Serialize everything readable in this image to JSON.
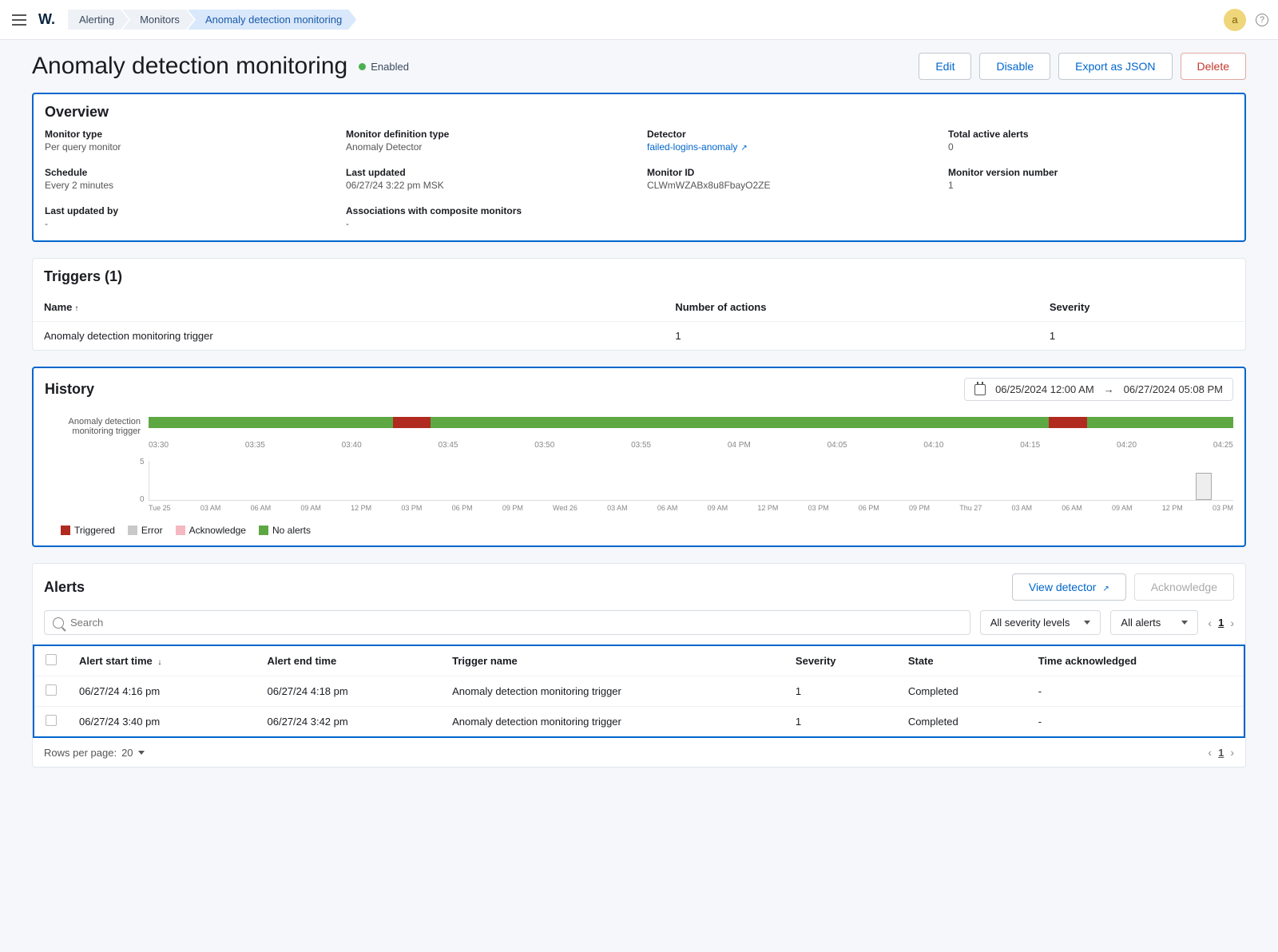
{
  "topbar": {
    "logo": "W.",
    "breadcrumbs": [
      "Alerting",
      "Monitors",
      "Anomaly detection monitoring"
    ],
    "avatar": "a"
  },
  "header": {
    "title": "Anomaly detection monitoring",
    "status": "Enabled",
    "actions": {
      "edit": "Edit",
      "disable": "Disable",
      "export": "Export as JSON",
      "delete": "Delete"
    }
  },
  "overview": {
    "title": "Overview",
    "monitor_type": {
      "label": "Monitor type",
      "value": "Per query monitor"
    },
    "definition_type": {
      "label": "Monitor definition type",
      "value": "Anomaly Detector"
    },
    "detector": {
      "label": "Detector",
      "value": "failed-logins-anomaly"
    },
    "total_active": {
      "label": "Total active alerts",
      "value": "0"
    },
    "schedule": {
      "label": "Schedule",
      "value": "Every 2 minutes"
    },
    "last_updated": {
      "label": "Last updated",
      "value": "06/27/24 3:22 pm MSK"
    },
    "monitor_id": {
      "label": "Monitor ID",
      "value": "CLWmWZABx8u8FbayO2ZE"
    },
    "version": {
      "label": "Monitor version number",
      "value": "1"
    },
    "last_updated_by": {
      "label": "Last updated by",
      "value": "-"
    },
    "associations": {
      "label": "Associations with composite monitors",
      "value": "-"
    }
  },
  "triggers": {
    "title": "Triggers (1)",
    "columns": {
      "name": "Name",
      "actions": "Number of actions",
      "severity": "Severity"
    },
    "rows": [
      {
        "name": "Anomaly detection monitoring trigger",
        "actions": "1",
        "severity": "1"
      }
    ]
  },
  "history": {
    "title": "History",
    "range_from": "06/25/2024 12:00 AM",
    "range_arrow": "→",
    "range_to": "06/27/2024 05:08 PM",
    "row_label": "Anomaly detection monitoring trigger",
    "ticks1": [
      "03:30",
      "03:35",
      "03:40",
      "03:45",
      "03:50",
      "03:55",
      "04 PM",
      "04:05",
      "04:10",
      "04:15",
      "04:20",
      "04:25"
    ],
    "y5": "5",
    "y0": "0",
    "ticks2": [
      "Tue 25",
      "03 AM",
      "06 AM",
      "09 AM",
      "12 PM",
      "03 PM",
      "06 PM",
      "09 PM",
      "Wed 26",
      "03 AM",
      "06 AM",
      "09 AM",
      "12 PM",
      "03 PM",
      "06 PM",
      "09 PM",
      "Thu 27",
      "03 AM",
      "06 AM",
      "09 AM",
      "12 PM",
      "03 PM"
    ],
    "legend": {
      "triggered": "Triggered",
      "error": "Error",
      "ack": "Acknowledge",
      "no": "No alerts"
    }
  },
  "chart_data": {
    "type": "bar",
    "timeline": {
      "label": "Anomaly detection monitoring trigger",
      "range": [
        "03:27",
        "04:29"
      ],
      "base_state": "no_alerts",
      "triggered_segments": [
        {
          "start": "03:41",
          "end": "03:43"
        },
        {
          "start": "04:17",
          "end": "04:19"
        }
      ]
    },
    "overview_chart": {
      "x_range": [
        "2024-06-25 00:00",
        "2024-06-27 17:08"
      ],
      "ylim": [
        0,
        5
      ],
      "brush": [
        "2024-06-27 15:27",
        "2024-06-27 16:29"
      ]
    },
    "legend_colors": {
      "Triggered": "#b02a1f",
      "Error": "#c9c9c9",
      "Acknowledge": "#f5b8c1",
      "No alerts": "#5ea843"
    }
  },
  "alerts": {
    "title": "Alerts",
    "view_detector": "View detector",
    "acknowledge": "Acknowledge",
    "search_placeholder": "Search",
    "filter_severity": "All severity levels",
    "filter_state": "All alerts",
    "page": "1",
    "columns": {
      "start": "Alert start time",
      "end": "Alert end time",
      "trigger": "Trigger name",
      "severity": "Severity",
      "state": "State",
      "ack": "Time acknowledged"
    },
    "rows": [
      {
        "start": "06/27/24 4:16 pm",
        "end": "06/27/24 4:18 pm",
        "trigger": "Anomaly detection monitoring trigger",
        "severity": "1",
        "state": "Completed",
        "ack": "-"
      },
      {
        "start": "06/27/24 3:40 pm",
        "end": "06/27/24 3:42 pm",
        "trigger": "Anomaly detection monitoring trigger",
        "severity": "1",
        "state": "Completed",
        "ack": "-"
      }
    ],
    "rows_per_page_label": "Rows per page:",
    "rows_per_page": "20"
  }
}
